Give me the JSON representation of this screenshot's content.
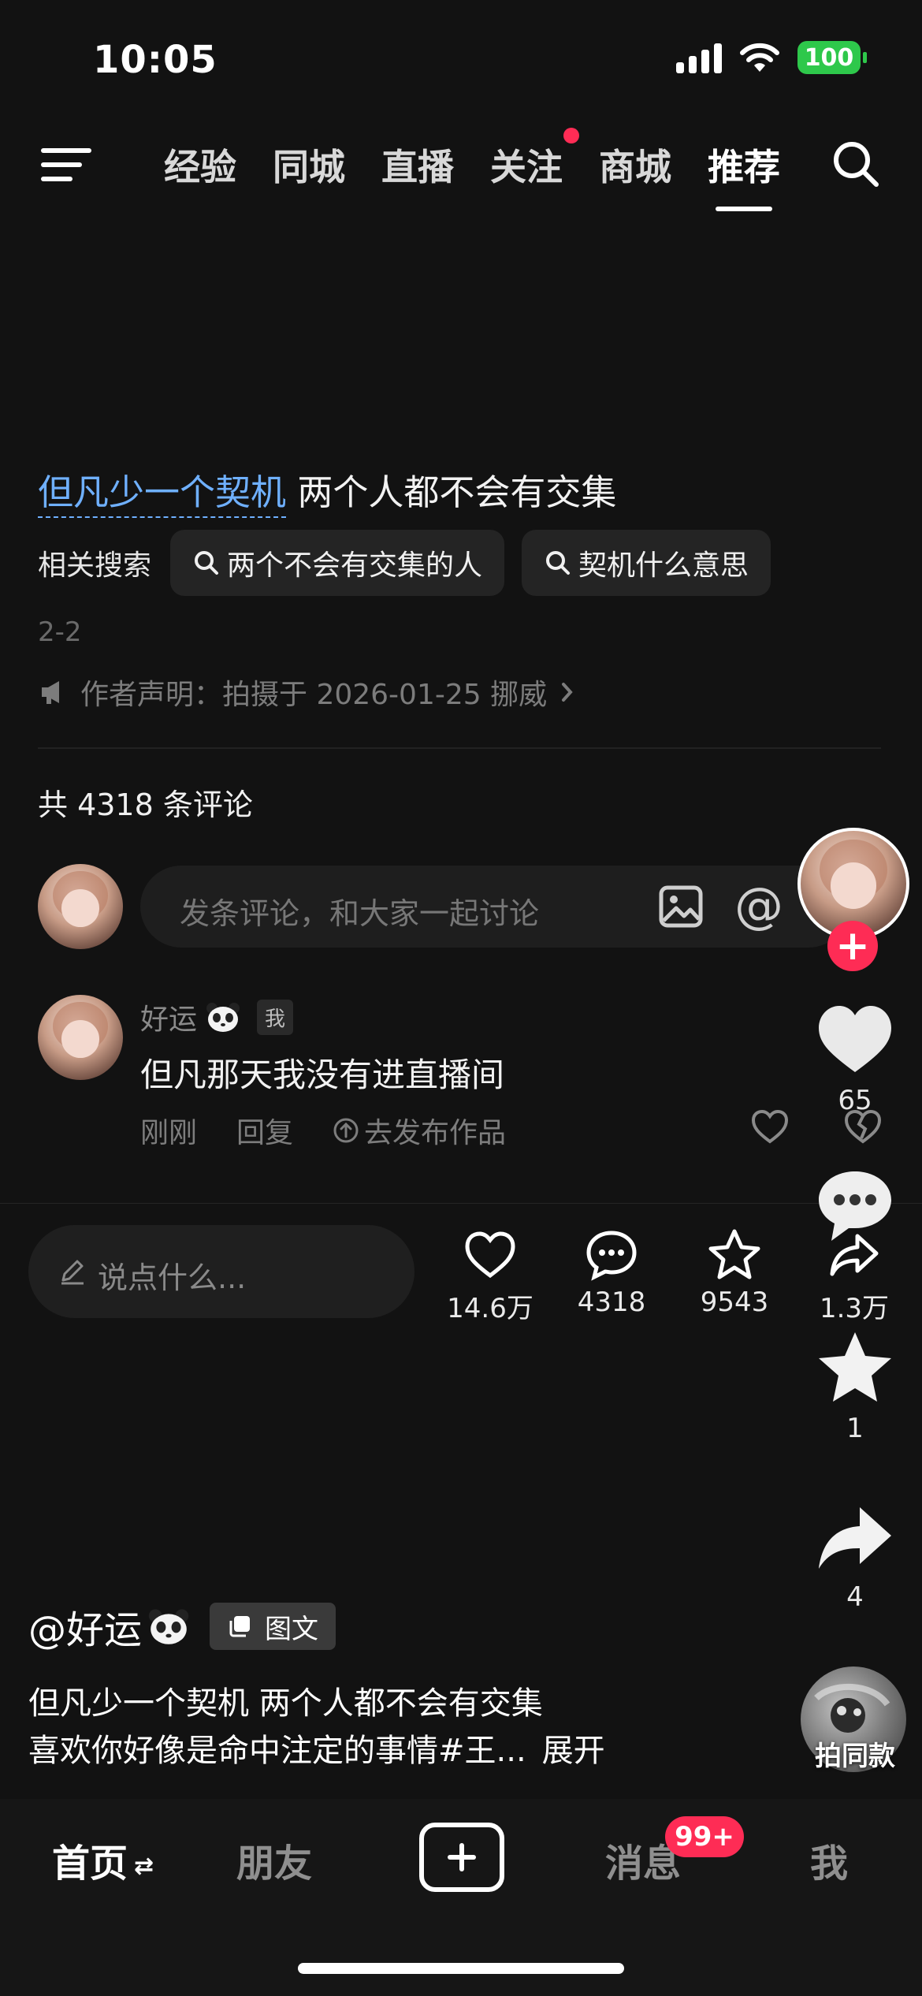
{
  "status": {
    "time": "10:05",
    "battery": "100"
  },
  "top_tabs": [
    "经验",
    "同城",
    "直播",
    "关注",
    "商城",
    "推荐"
  ],
  "post": {
    "title_highlight": "但凡少一个契机",
    "title_rest": "两个人都不会有交集",
    "related_label": "相关搜索",
    "related_chips": [
      "两个不会有交集的人",
      "契机什么意思"
    ],
    "page": "2-2",
    "declaration": "作者声明：拍摄于 2026-01-25 挪威"
  },
  "comments": {
    "count_text": "共 4318 条评论",
    "input_placeholder": "发条评论，和大家一起讨论",
    "items": [
      {
        "name": "好运",
        "tag": "我",
        "text": "但凡那天我没有进直播间",
        "time": "刚刚",
        "reply": "回复",
        "publish": "去发布作品"
      }
    ]
  },
  "action_bar": {
    "say_placeholder": "说点什么...",
    "likes": "14.6万",
    "comments": "4318",
    "favorites": "9543",
    "shares": "1.3万"
  },
  "rail": {
    "like_count": "65",
    "star_count": "1",
    "share_count": "4",
    "same_style": "拍同款"
  },
  "caption": {
    "author": "@好运",
    "type_tag": "图文",
    "line1": "但凡少一个契机 两个人都不会有交集",
    "line2": "喜欢你好像是命中注定的事情#王...",
    "expand": "展开"
  },
  "bottom_nav": {
    "home": "首页",
    "friends": "朋友",
    "messages": "消息",
    "badge": "99+",
    "me": "我"
  },
  "colors": {
    "accent": "#fe2c55",
    "link": "#6fb0ff",
    "battery": "#2ec84b"
  }
}
